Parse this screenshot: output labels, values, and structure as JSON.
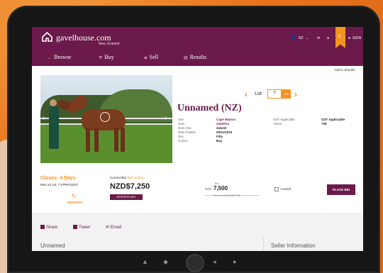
{
  "header": {
    "logo_text": "gavelhouse.com",
    "logo_sub": "New Zealand",
    "nav": [
      {
        "label": "Browse",
        "icon": "arrows-icon"
      },
      {
        "label": "Buy",
        "icon": "gavel-icon"
      },
      {
        "label": "Sell",
        "icon": "tag-icon"
      },
      {
        "label": "Results",
        "icon": "list-icon"
      }
    ],
    "currency": "NZ",
    "cart_count": "0",
    "signin_label": "SIGN"
  },
  "shortlist_label": "Add to Shortlis",
  "lot": {
    "label": "Lot",
    "input_value": "?",
    "go_label": "GO"
  },
  "listing": {
    "title": "Unnamed (NZ)",
    "details_left": [
      {
        "key": "Sire",
        "value": "Cape Blanco",
        "link": true
      },
      {
        "key": "Dam",
        "value": "Zakelina",
        "link": true
      },
      {
        "key": "Dam Sire",
        "value": "Zabeel",
        "link": false
      },
      {
        "key": "Date Foaled",
        "value": "05/11/2015",
        "link": false
      },
      {
        "key": "Sex",
        "value": "Filly",
        "link": false
      },
      {
        "key": "Colour",
        "value": "Bay",
        "link": false
      }
    ],
    "details_right": [
      {
        "key": "GST Applicable",
        "value": "GST Applicable"
      },
      {
        "key": "Views",
        "value": "739"
      }
    ]
  },
  "auction": {
    "closes_label": "Closes: 4 Days",
    "closes_date": "Mon 24 Jul, 7:47PM NZST",
    "refresh_label": "REFRESH",
    "current_bid_label": "Current Bid",
    "current_bid_note": "(Bid History)",
    "current_bid_value": "NZD$7,250",
    "reserve_label": "RESERVE MET",
    "bid_tiny": "Bid",
    "bid_currency": "NZD",
    "bid_value": "7,500",
    "bid_next": "Min next bid NZD$7,500",
    "autobid_label": "Autobid",
    "place_bid_label": "PLACE BID"
  },
  "share": {
    "items": [
      {
        "label": "Share",
        "icon": "facebook-icon"
      },
      {
        "label": "Tweet",
        "icon": "twitter-icon"
      },
      {
        "label": "Email",
        "icon": "email-icon"
      }
    ]
  },
  "tabs": {
    "left": "Unnamed",
    "right": "Seller Information"
  },
  "colors": {
    "brand": "#6b1a4b",
    "accent": "#f39321",
    "background": "#e8731c"
  }
}
